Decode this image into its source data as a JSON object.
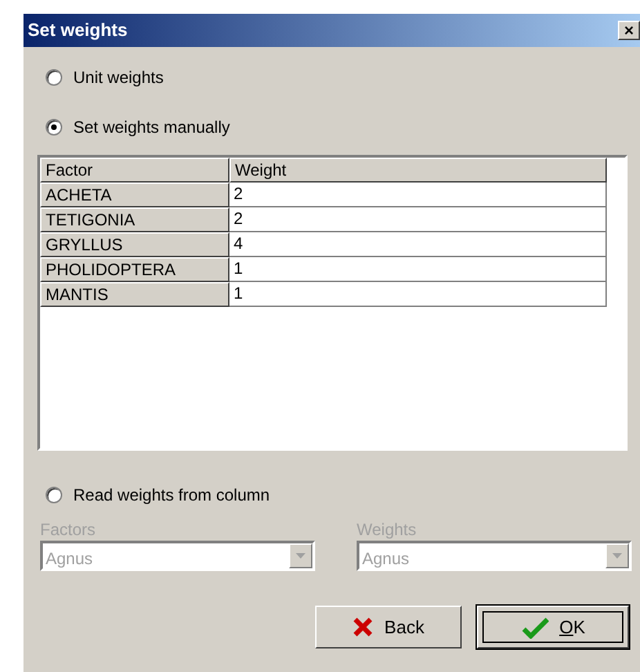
{
  "window": {
    "title": "Set weights",
    "close": "×"
  },
  "options": [
    {
      "label": "Unit weights",
      "selected": false
    },
    {
      "label": "Set weights manually",
      "selected": true
    }
  ],
  "table": {
    "columns": [
      "Factor",
      "Weight"
    ],
    "rows": [
      {
        "factor": "ACHETA",
        "weight": "2"
      },
      {
        "factor": "TETIGONIA",
        "weight": "2"
      },
      {
        "factor": "GRYLLUS",
        "weight": "4"
      },
      {
        "factor": "PHOLIDOPTERA",
        "weight": "1"
      },
      {
        "factor": "MANTIS",
        "weight": "1"
      }
    ]
  },
  "column_option": {
    "label": "Read weights from column",
    "selected": false
  },
  "combos": [
    {
      "label": "Factors",
      "value": "Agnus",
      "disabled": true
    },
    {
      "label": "Weights",
      "value": "Agnus",
      "disabled": true
    }
  ],
  "buttons": [
    {
      "kind": "back",
      "label": "Back",
      "default": false
    },
    {
      "kind": "ok",
      "label": "OK",
      "default": true
    }
  ]
}
